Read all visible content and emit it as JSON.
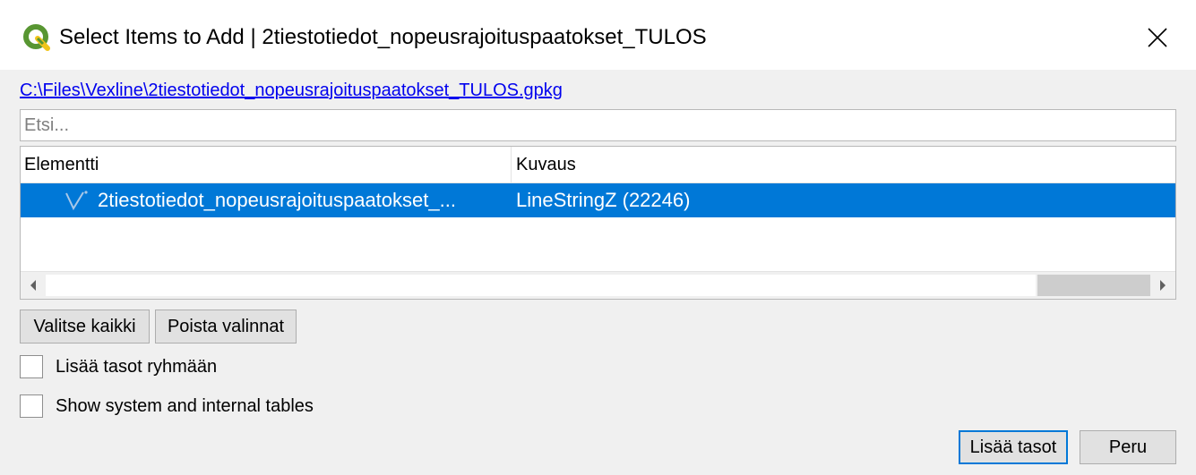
{
  "window": {
    "title": "Select Items to Add | 2tiestotiedot_nopeusrajoituspaatokset_TULOS",
    "app_icon": "qgis-logo-icon",
    "close_icon": "close-icon"
  },
  "file_path": "C:\\Files\\Vexline\\2tiestotiedot_nopeusrajoituspaatokset_TULOS.gpkg",
  "search": {
    "placeholder": "Etsi...",
    "value": ""
  },
  "table": {
    "columns": [
      "Elementti",
      "Kuvaus"
    ],
    "rows": [
      {
        "icon": "linestring-geometry-icon",
        "element": "2tiestotiedot_nopeusrajoituspaatokset_...",
        "description": "LineStringZ (22246)",
        "selected": true
      }
    ]
  },
  "buttons": {
    "select_all": "Valitse kaikki",
    "deselect": "Poista valinnat",
    "add_layers": "Lisää tasot",
    "cancel": "Peru"
  },
  "checkboxes": {
    "add_to_group": {
      "label": "Lisää tasot ryhmään",
      "checked": false
    },
    "show_system_tables": {
      "label": "Show system and internal tables",
      "checked": false
    }
  },
  "colors": {
    "selection": "#0078d7",
    "link": "#0000ee",
    "qgis_green": "#589632",
    "qgis_yellow": "#f0c419"
  }
}
